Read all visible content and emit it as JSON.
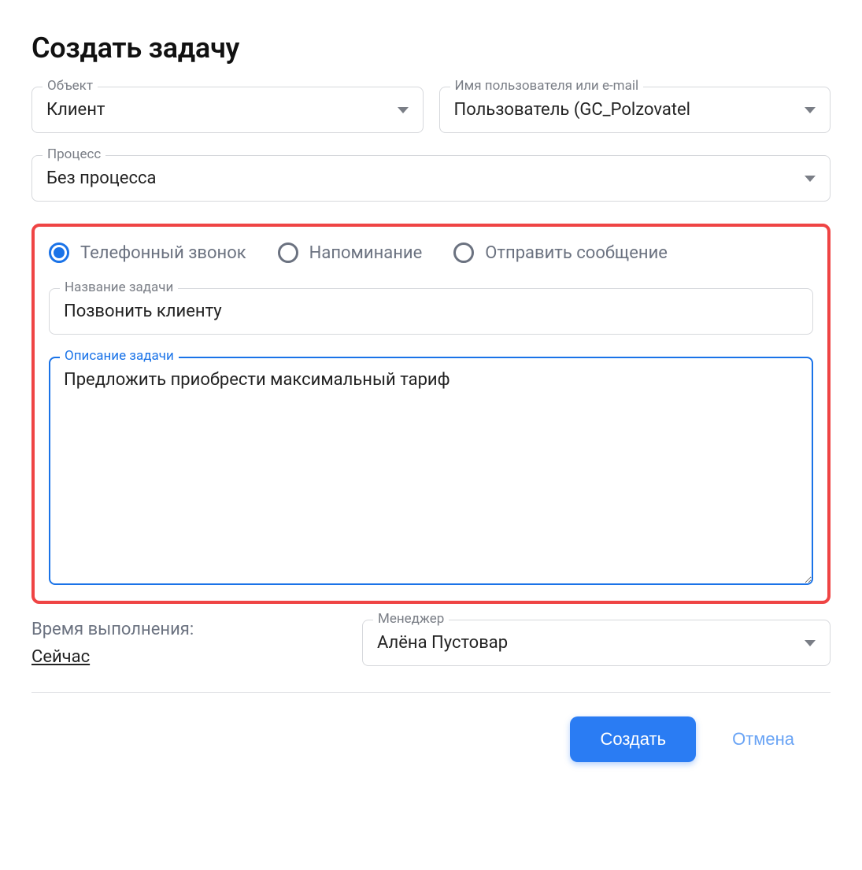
{
  "title": "Создать задачу",
  "fields": {
    "object": {
      "label": "Объект",
      "value": "Клиент"
    },
    "user": {
      "label": "Имя пользователя или e-mail",
      "value": "Пользователь (GC_Polzovatel"
    },
    "process": {
      "label": "Процесс",
      "value": "Без процесса"
    },
    "taskName": {
      "label": "Название задачи",
      "value": "Позвонить клиенту"
    },
    "taskDesc": {
      "label": "Описание задачи",
      "value": "Предложить приобрести максимальный тариф"
    },
    "manager": {
      "label": "Менеджер",
      "value": "Алёна Пустовар"
    }
  },
  "radios": {
    "phone": "Телефонный звонок",
    "reminder": "Напоминание",
    "message": "Отправить сообщение"
  },
  "time": {
    "label": "Время выполнения:",
    "value": "Сейчас"
  },
  "buttons": {
    "create": "Создать",
    "cancel": "Отмена"
  }
}
